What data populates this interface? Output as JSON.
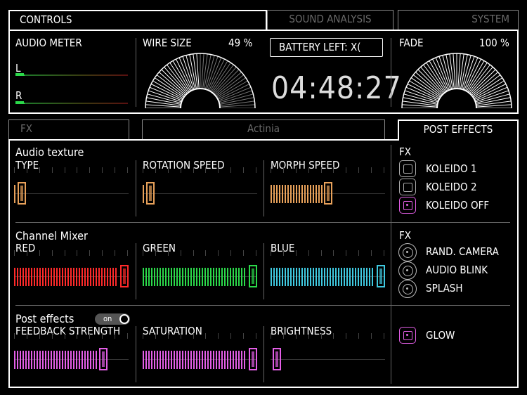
{
  "tabs_top": [
    {
      "label": "CONTROLS",
      "active": true
    },
    {
      "label": "SOUND ANALYSIS",
      "active": false
    },
    {
      "label": "SYSTEM",
      "active": false
    }
  ],
  "top_panel": {
    "audio_meter_label": "AUDIO METER",
    "channel_l": "L",
    "channel_r": "R",
    "wire_size_label": "WIRE SIZE",
    "wire_size_value": "49 %",
    "wire_size_level": 0.49,
    "battery_label": "BATTERY LEFT: X(",
    "clock": "04:48:27",
    "fade_label": "FADE",
    "fade_value": "100 %",
    "fade_level": 1.0
  },
  "tabs_mid": [
    {
      "label": "FX",
      "active": false
    },
    {
      "label": "Actinia",
      "active": false
    },
    {
      "label": "POST EFFECTS",
      "active": true
    }
  ],
  "sections": {
    "audio_texture": {
      "title": "Audio texture",
      "sliders": [
        {
          "label": "TYPE",
          "level": 0.03,
          "color": "#e8a15a"
        },
        {
          "label": "ROTATION SPEED",
          "level": 0.03,
          "color": "#e8a15a"
        },
        {
          "label": "MORPH SPEED",
          "level": 0.5,
          "color": "#e8a15a"
        }
      ]
    },
    "channel_mixer": {
      "title": "Channel Mixer",
      "sliders": [
        {
          "label": "RED",
          "level": 1.0,
          "color": "#ff2a2a"
        },
        {
          "label": "GREEN",
          "level": 1.0,
          "color": "#2bd94a"
        },
        {
          "label": "BLUE",
          "level": 1.0,
          "color": "#3fc9e0"
        }
      ]
    },
    "post_effects": {
      "title": "Post effects",
      "toggle_label": "on",
      "sliders": [
        {
          "label": "FEEDBACK STRENGTH",
          "level": 0.8,
          "color": "#e35ee6"
        },
        {
          "label": "SATURATION",
          "level": 1.0,
          "color": "#e35ee6"
        },
        {
          "label": "BRIGHTNESS",
          "level": 0.02,
          "color": "#e35ee6"
        }
      ]
    }
  },
  "fx_group_1": {
    "title": "FX",
    "items": [
      {
        "label": "KOLEIDO 1",
        "selected": false
      },
      {
        "label": "KOLEIDO 2",
        "selected": false
      },
      {
        "label": "KOLEIDO OFF",
        "selected": true
      }
    ]
  },
  "fx_group_2": {
    "title": "FX",
    "items": [
      {
        "label": "RAND. CAMERA"
      },
      {
        "label": "AUDIO BLINK"
      },
      {
        "label": "SPLASH"
      }
    ]
  },
  "glow": {
    "label": "GLOW",
    "selected": true
  },
  "colors": {
    "accent_pink": "#e35ee6",
    "accent_orange": "#e8a15a",
    "red": "#ff2a2a",
    "green": "#2bd94a",
    "blue": "#3fc9e0"
  }
}
